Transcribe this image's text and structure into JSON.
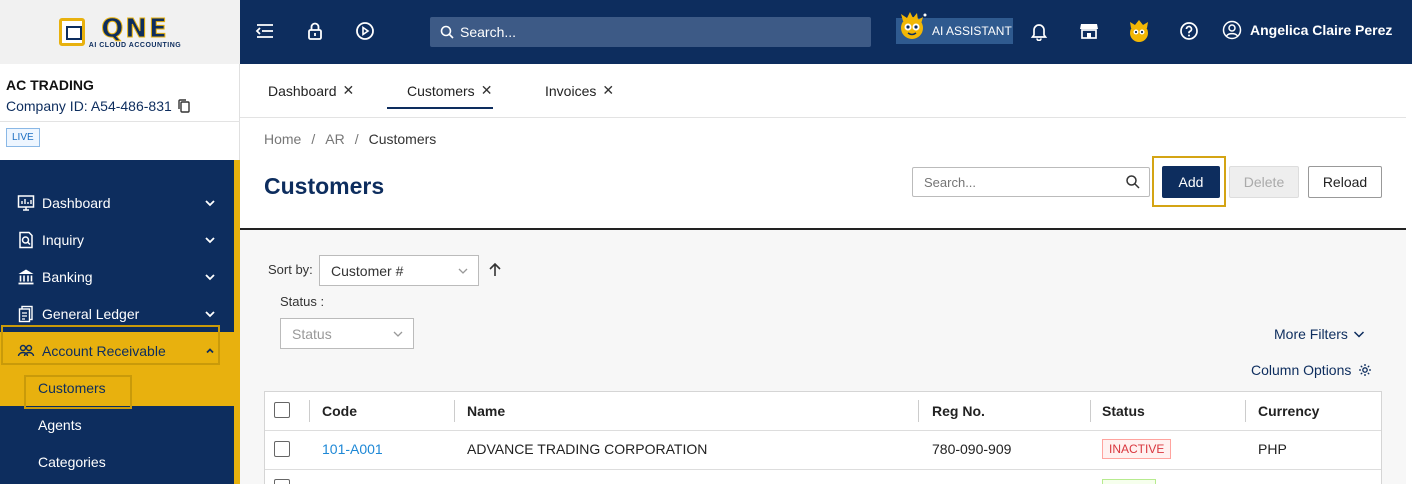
{
  "app": {
    "logo_text": "QNE",
    "logo_subtext": "AI CLOUD ACCOUNTING"
  },
  "topbar": {
    "search_label": "Search...",
    "ai_assistant_label": "AI ASSISTANT",
    "user_name": "Angelica Claire Perez"
  },
  "company": {
    "name": "AC TRADING",
    "id_label": "Company ID: A54-486-831",
    "env_badge": "LIVE"
  },
  "sidebar": {
    "items": [
      {
        "label": "Dashboard",
        "icon": "dashboard-icon"
      },
      {
        "label": "Inquiry",
        "icon": "inquiry-icon"
      },
      {
        "label": "Banking",
        "icon": "bank-icon"
      },
      {
        "label": "General Ledger",
        "icon": "ledger-icon"
      },
      {
        "label": "Account Receivable",
        "icon": "receivable-icon"
      }
    ],
    "sub_items": [
      {
        "label": "Customers"
      },
      {
        "label": "Agents"
      },
      {
        "label": "Categories"
      }
    ]
  },
  "tabs": [
    {
      "label": "Dashboard"
    },
    {
      "label": "Customers"
    },
    {
      "label": "Invoices"
    }
  ],
  "breadcrumb": {
    "home": "Home",
    "sep": "/",
    "section": "AR",
    "current": "Customers"
  },
  "page": {
    "title": "Customers",
    "search_placeholder": "Search...",
    "add_label": "Add",
    "delete_label": "Delete",
    "reload_label": "Reload"
  },
  "filters": {
    "sort_by_label": "Sort by:",
    "sort_by_value": "Customer #",
    "status_label": "Status :",
    "status_placeholder": "Status",
    "more_filters_label": "More Filters",
    "column_options_label": "Column Options"
  },
  "table": {
    "headers": {
      "code": "Code",
      "name": "Name",
      "reg_no": "Reg No.",
      "status": "Status",
      "currency": "Currency"
    },
    "rows": [
      {
        "code": "101-A001",
        "name": "ADVANCE TRADING CORPORATION",
        "reg_no": "780-090-909",
        "status": "INACTIVE",
        "currency": "PHP"
      }
    ]
  },
  "colors": {
    "brand_navy": "#0d2d5e",
    "accent_gold": "#e8b10e",
    "link_blue": "#1e88d6",
    "inactive_red": "#d9363e"
  }
}
